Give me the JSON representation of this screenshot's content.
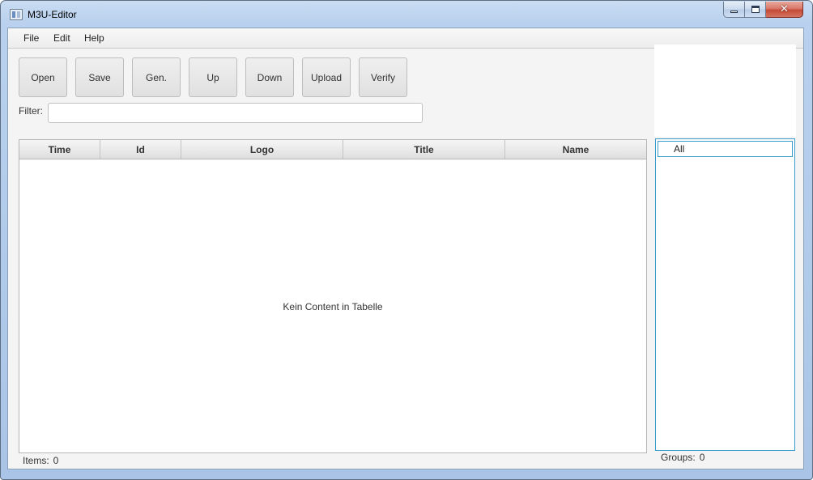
{
  "window": {
    "title": "M3U-Editor",
    "close_glyph": "✕"
  },
  "menu": {
    "items": [
      {
        "label": "File"
      },
      {
        "label": "Edit"
      },
      {
        "label": "Help"
      }
    ]
  },
  "toolbar": {
    "buttons": [
      {
        "label": "Open"
      },
      {
        "label": "Save"
      },
      {
        "label": "Gen."
      },
      {
        "label": "Up"
      },
      {
        "label": "Down"
      },
      {
        "label": "Upload"
      },
      {
        "label": "Verify"
      }
    ]
  },
  "filter": {
    "label": "Filter:",
    "value": "",
    "placeholder": ""
  },
  "table": {
    "columns": [
      "Time",
      "Id",
      "Logo",
      "Title",
      "Name"
    ],
    "rows": [],
    "empty_text": "Kein Content in Tabelle"
  },
  "groups": {
    "items": [
      {
        "label": "All",
        "selected": true
      }
    ]
  },
  "status": {
    "items_label": "Items:",
    "items_count": "0",
    "groups_label": "Groups:",
    "groups_count": "0"
  },
  "colors": {
    "selection_border": "#3b9ccc",
    "close_button": "#c44a36"
  }
}
